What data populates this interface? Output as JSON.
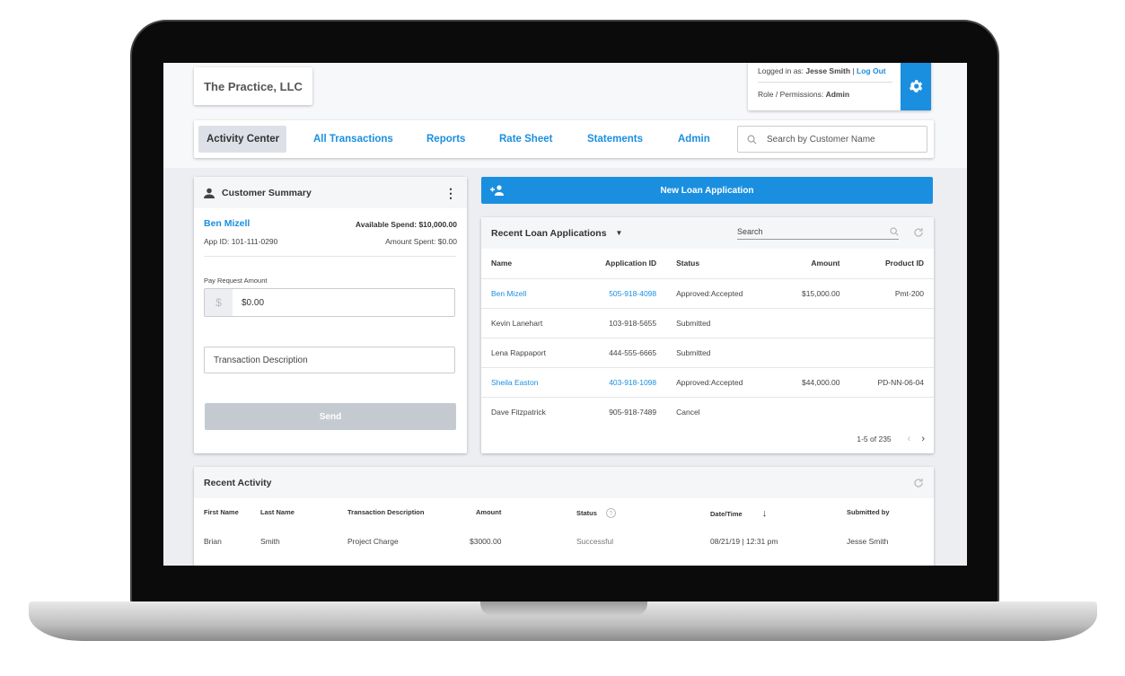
{
  "header": {
    "company": "The Practice, LLC",
    "logged_in_label": "Logged in as:",
    "user": "Jesse Smith",
    "separator": "|",
    "logout": "Log Out",
    "role_label": "Role / Permissions:",
    "role": "Admin"
  },
  "nav": {
    "items": [
      "Activity Center",
      "All Transactions",
      "Reports",
      "Rate Sheet",
      "Statements",
      "Admin"
    ],
    "active": "Activity Center",
    "search_placeholder": "Search by Customer Name"
  },
  "customer": {
    "title": "Customer Summary",
    "name": "Ben Mizell",
    "app_id": "App ID: 101-111-0290",
    "available": "Available Spend: $10,000.00",
    "spent": "Amount Spent: $0.00",
    "pay_label": "Pay Request Amount",
    "currency": "$",
    "amount_value": "$0.00",
    "desc_placeholder": "Transaction Description",
    "send": "Send"
  },
  "new_loan": "New Loan Application",
  "loans": {
    "title": "Recent Loan Applications",
    "search_placeholder": "Search",
    "columns": [
      "Name",
      "Application ID",
      "Status",
      "Amount",
      "Product ID"
    ],
    "rows": [
      {
        "name": "Ben Mizell",
        "id": "505-918-4098",
        "status": "Approved:Accepted",
        "amount": "$15,000.00",
        "product": "Pmt-200",
        "link": true
      },
      {
        "name": "Kevin Lanehart",
        "id": "103-918-5655",
        "status": "Submitted",
        "amount": "",
        "product": "",
        "link": false
      },
      {
        "name": "Lena Rappaport",
        "id": "444-555-6665",
        "status": "Submitted",
        "amount": "",
        "product": "",
        "link": false
      },
      {
        "name": "Sheila Easton",
        "id": "403-918-1098",
        "status": "Approved:Accepted",
        "amount": "$44,000.00",
        "product": "PD-NN-06-04",
        "link": true
      },
      {
        "name": "Dave Fitzpatrick",
        "id": "905-918-7489",
        "status": "Cancel",
        "amount": "",
        "product": "",
        "link": false
      }
    ],
    "pagination": "1-5 of 235"
  },
  "activity": {
    "title": "Recent Activity",
    "columns": [
      "First Name",
      "Last Name",
      "Transaction Description",
      "Amount",
      "Status",
      "Date/Time",
      "Submitted by"
    ],
    "rows": [
      {
        "first": "Brian",
        "last": "Smith",
        "desc": "Project Charge",
        "amount": "$3000.00",
        "status": "Successful",
        "date": "08/21/19 | 12:31 pm",
        "by": "Jesse Smith"
      }
    ]
  },
  "colors": {
    "accent": "#1a8fe0",
    "active_tab_bg": "#dde1e7",
    "send_disabled": "#c5cad1"
  }
}
